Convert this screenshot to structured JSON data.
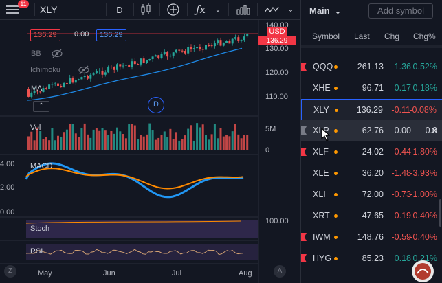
{
  "toolbar": {
    "notification_count": "11",
    "symbol": "XLY",
    "interval": "D"
  },
  "chart": {
    "current_price": "136.29",
    "change": "0.00",
    "price_right": "136.29",
    "currency": "USD",
    "indicators": {
      "bb": "BB",
      "ichimoku": "Ichimoku",
      "ma": "MA",
      "vol": "Vol",
      "macd": "MACD",
      "stoch": "Stoch",
      "rsi": "RSI"
    },
    "price_axis": [
      "140.00",
      "130.00",
      "120.00",
      "110.00"
    ],
    "vol_axis": [
      "5M",
      "0"
    ],
    "macd_axis": [
      "4.00",
      "2.00",
      "0.00"
    ],
    "stoch_axis": [
      "100.00"
    ],
    "time_axis": [
      "May",
      "Jun",
      "Jul",
      "Aug"
    ],
    "dividend_marker": "D",
    "bottom_left_marker": "Z",
    "bottom_right_marker": "A"
  },
  "watchlist": {
    "list_name": "Main",
    "add_symbol_placeholder": "Add symbol",
    "columns": {
      "symbol": "Symbol",
      "last": "Last",
      "chg": "Chg",
      "chgp": "Chg%"
    },
    "rows": [
      {
        "symbol": "QQQ",
        "last": "261.13",
        "chg": "1.36",
        "chgp": "0.52%",
        "dir": "up",
        "flag": true
      },
      {
        "symbol": "XHE",
        "last": "96.71",
        "chg": "0.17",
        "chgp": "0.18%",
        "dir": "up",
        "flag": false
      },
      {
        "symbol": "XLY",
        "last": "136.29",
        "chg": "-0.11",
        "chgp": "-0.08%",
        "dir": "down",
        "flag": false
      },
      {
        "symbol": "XLP",
        "last": "62.76",
        "chg": "0.00",
        "chgp": "0.0",
        "dir": "flat",
        "flag": false
      },
      {
        "symbol": "XLF",
        "last": "24.02",
        "chg": "-0.44",
        "chgp": "-1.80%",
        "dir": "down",
        "flag": true
      },
      {
        "symbol": "XLE",
        "last": "36.20",
        "chg": "-1.48",
        "chgp": "-3.93%",
        "dir": "down",
        "flag": false
      },
      {
        "symbol": "XLI",
        "last": "72.00",
        "chg": "-0.73",
        "chgp": "-1.00%",
        "dir": "down",
        "flag": false
      },
      {
        "symbol": "XRT",
        "last": "47.65",
        "chg": "-0.19",
        "chgp": "-0.40%",
        "dir": "down",
        "flag": false
      },
      {
        "symbol": "IWM",
        "last": "148.76",
        "chg": "-0.59",
        "chgp": "-0.40%",
        "dir": "down",
        "flag": true
      },
      {
        "symbol": "HYG",
        "last": "85.23",
        "chg": "0.18",
        "chgp": "0.21%",
        "dir": "up",
        "flag": true
      }
    ]
  },
  "colors": {
    "background": "#131722",
    "up": "#26a69a",
    "down": "#ef5350",
    "accent": "#2962ff",
    "flag": "#f23645",
    "ma_line": "#1e88e5",
    "macd_line": "#2196f3",
    "signal_line": "#ff8a00"
  }
}
